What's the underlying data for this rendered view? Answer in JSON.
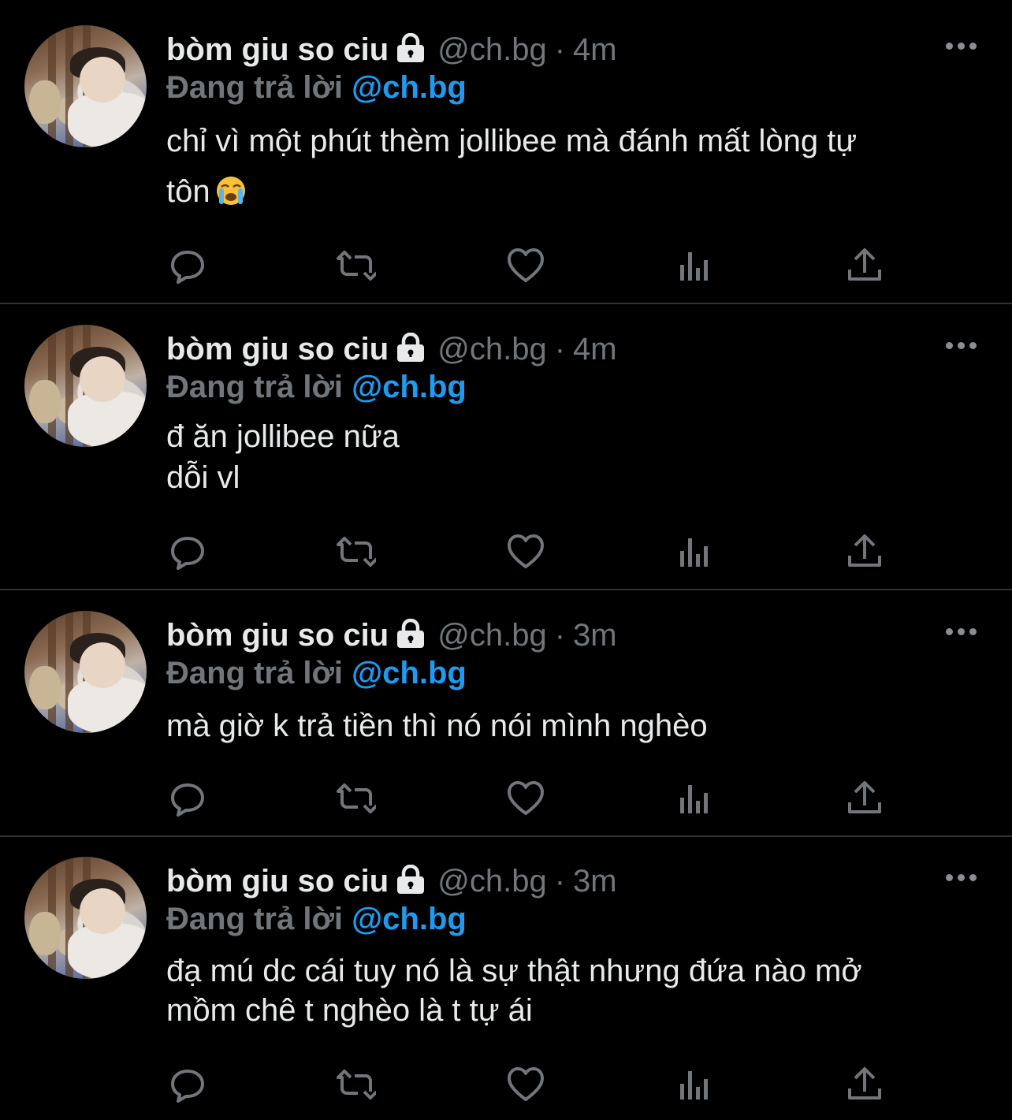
{
  "tweets": [
    {
      "author_name": "bòm giu so ciu",
      "handle": "@ch.bg",
      "dot": "·",
      "time": "4m",
      "reply_prefix": "Đang trả lời",
      "reply_mention": "@ch.bg",
      "lines": [
        "chỉ vì một phút thèm jollibee mà đánh mất lòng tự",
        "tôn"
      ],
      "emoji": "loudly-crying-face"
    },
    {
      "author_name": "bòm giu so ciu",
      "handle": "@ch.bg",
      "dot": "·",
      "time": "4m",
      "reply_prefix": "Đang trả lời",
      "reply_mention": "@ch.bg",
      "lines": [
        "đ ăn jollibee nữa",
        "dỗi vl"
      ]
    },
    {
      "author_name": "bòm giu so ciu",
      "handle": "@ch.bg",
      "dot": "·",
      "time": "3m",
      "reply_prefix": "Đang trả lời",
      "reply_mention": "@ch.bg",
      "lines": [
        "mà giờ k trả tiền thì nó nói mình nghèo"
      ]
    },
    {
      "author_name": "bòm giu so ciu",
      "handle": "@ch.bg",
      "dot": "·",
      "time": "3m",
      "reply_prefix": "Đang trả lời",
      "reply_mention": "@ch.bg",
      "lines": [
        "đạ mú dc cái tuy nó là sự thật nhưng đứa nào mở",
        "mồm chê t nghèo là t tự ái"
      ]
    }
  ],
  "icons": {
    "reply": "reply-icon",
    "retweet": "retweet-icon",
    "like": "heart-icon",
    "views": "views-icon",
    "share": "share-icon",
    "more": "more-icon",
    "lock": "lock-icon"
  },
  "colors": {
    "background": "#000000",
    "text": "#e7e9ea",
    "secondary": "#71767b",
    "mention": "#1d9bf0",
    "separator": "#2f3336"
  }
}
